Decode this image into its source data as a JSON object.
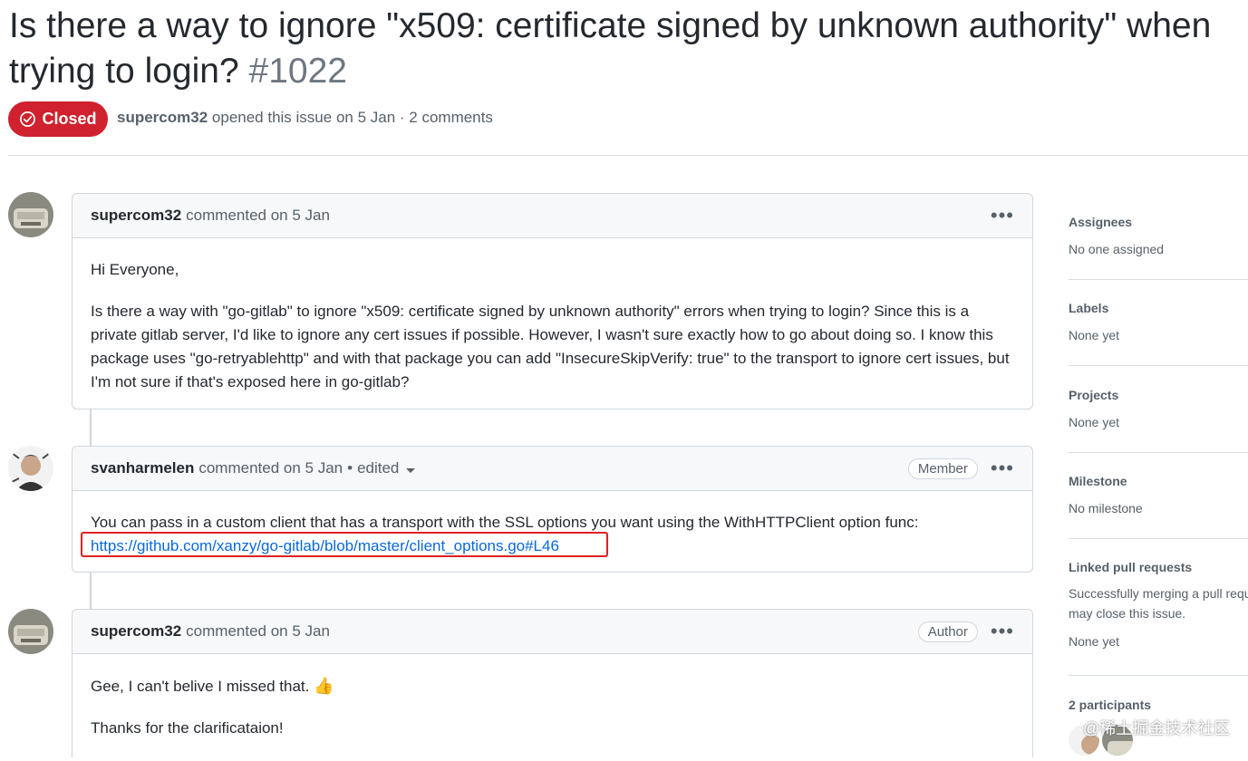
{
  "issue": {
    "title_line1": "Is there a way to ignore \"x509: certificate signed by unknown authority\" when",
    "title_line2": "trying to login?",
    "number": "#1022",
    "state": "Closed",
    "author": "supercom32",
    "meta_text": "opened this issue on 5 Jan · 2 comments"
  },
  "comments": [
    {
      "author": "supercom32",
      "action": "commented on 5 Jan",
      "paragraphs": [
        "Hi Everyone,",
        "Is there a way with \"go-gitlab\" to ignore \"x509: certificate signed by unknown authority\" errors when trying to login? Since this is a private gitlab server, I'd like to ignore any cert issues if possible. However, I wasn't sure exactly how to go about doing so. I know this package uses \"go-retryablehttp\" and with that package you can add \"InsecureSkipVerify: true\" to the transport to ignore cert issues, but I'm not sure if that's exposed here in go-gitlab?"
      ]
    },
    {
      "author": "svanharmelen",
      "action": "commented on 5 Jan",
      "edited": "edited",
      "role": "Member",
      "text": "You can pass in a custom client that has a transport with the SSL options you want using the WithHTTPClient option func:",
      "link": "https://github.com/xanzy/go-gitlab/blob/master/client_options.go#L46"
    },
    {
      "author": "supercom32",
      "action": "commented on 5 Jan",
      "role": "Author",
      "line1": "Gee, I can't belive I missed that.",
      "emoji": "👍",
      "line2": "Thanks for the clarificataion!"
    }
  ],
  "sidebar": {
    "assignees": {
      "heading": "Assignees",
      "value": "No one assigned"
    },
    "labels": {
      "heading": "Labels",
      "value": "None yet"
    },
    "projects": {
      "heading": "Projects",
      "value": "None yet"
    },
    "milestone": {
      "heading": "Milestone",
      "value": "No milestone"
    },
    "linked_prs": {
      "heading": "Linked pull requests",
      "value": "Successfully merging a pull request may close this issue.",
      "value2": "None yet"
    },
    "participants": {
      "heading": "2 participants"
    }
  },
  "watermark": "@稀土掘金技术社区",
  "colors": {
    "closed": "#cf222e",
    "link": "#0969da",
    "highlight": "#e02020"
  }
}
